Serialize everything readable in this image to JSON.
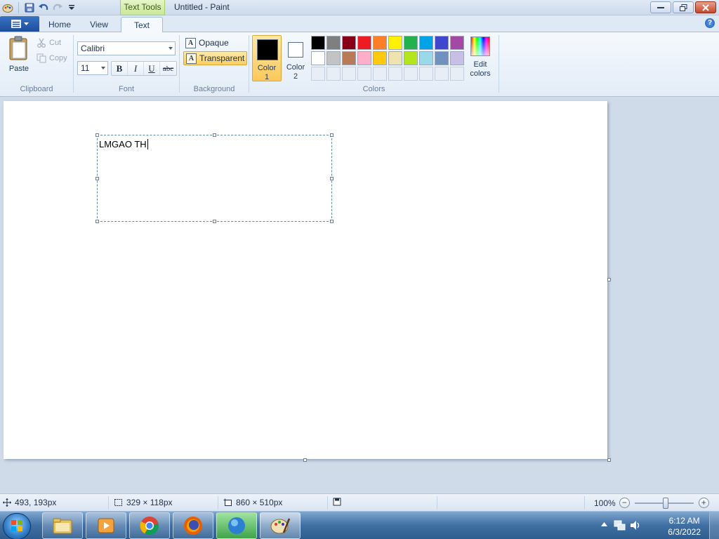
{
  "window": {
    "title": "Untitled - Paint",
    "contextual_tab": "Text Tools"
  },
  "tabs": [
    {
      "label": "Home"
    },
    {
      "label": "View"
    },
    {
      "label": "Text"
    }
  ],
  "clipboard": {
    "paste": "Paste",
    "cut": "Cut",
    "copy": "Copy",
    "group": "Clipboard"
  },
  "font": {
    "family": "Calibri",
    "size": "11",
    "bold": "B",
    "italic": "I",
    "underline": "U",
    "strike": "abc",
    "group": "Font"
  },
  "background": {
    "opaque": "Opaque",
    "transparent": "Transparent",
    "selected": "transparent",
    "group": "Background"
  },
  "colors": {
    "color1": {
      "line1": "Color",
      "line2": "1",
      "value": "#000000"
    },
    "color2": {
      "line1": "Color",
      "line2": "2",
      "value": "#ffffff"
    },
    "palette": [
      "#000000",
      "#7f7f7f",
      "#880015",
      "#ed1c24",
      "#ff7f27",
      "#fff200",
      "#22b14c",
      "#00a2e8",
      "#3f48cc",
      "#a349a4",
      "#ffffff",
      "#c3c3c3",
      "#b97a57",
      "#ffaec9",
      "#ffc90e",
      "#efe4b0",
      "#b5e61d",
      "#99d9ea",
      "#7092be",
      "#c8bfe7"
    ],
    "custom_slots": 10,
    "edit": {
      "line1": "Edit",
      "line2": "colors"
    },
    "group": "Colors"
  },
  "canvas": {
    "text": "LMGAO TH"
  },
  "status": {
    "cursor": "493, 193px",
    "selection": "329 × 118px",
    "canvas_size": "860 × 510px",
    "zoom": "100%"
  },
  "taskbar": {
    "time": "6:12 AM",
    "date": "6/3/2022"
  }
}
